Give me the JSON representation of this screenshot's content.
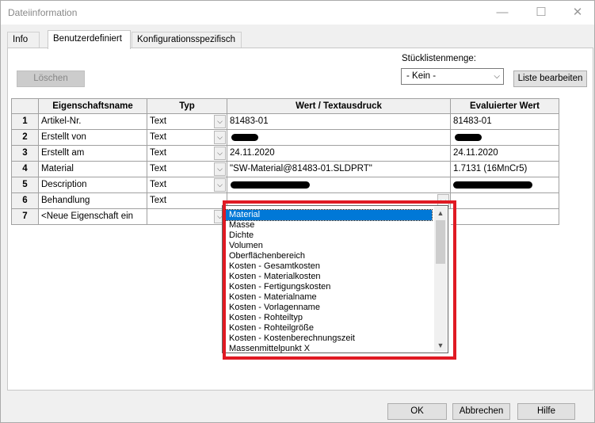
{
  "window": {
    "title": "Dateiinformation",
    "minimize_icon": "—",
    "maximize_icon": "☐",
    "close_icon": "✕"
  },
  "tabs": [
    {
      "label": "Info",
      "active": false
    },
    {
      "label": "Benutzerdefiniert",
      "active": true
    },
    {
      "label": "Konfigurationsspezifisch",
      "active": false
    }
  ],
  "toolbar": {
    "delete_label": "Löschen",
    "bom_quantity_label": "Stücklistenmenge:",
    "bom_quantity_value": "- Kein -",
    "edit_list_label": "Liste bearbeiten"
  },
  "table": {
    "headers": [
      "Eigenschaftsname",
      "Typ",
      "Wert / Textausdruck",
      "Evaluierter Wert"
    ],
    "rows": [
      {
        "num": "1",
        "name": "Artikel-Nr.",
        "type": "Text",
        "value": "81483-01",
        "evaluated": "81483-01"
      },
      {
        "num": "2",
        "name": "Erstellt von",
        "type": "Text",
        "value": "",
        "evaluated": ""
      },
      {
        "num": "3",
        "name": "Erstellt am",
        "type": "Text",
        "value": "24.11.2020",
        "evaluated": "24.11.2020"
      },
      {
        "num": "4",
        "name": "Material",
        "type": "Text",
        "value": "\"SW-Material@81483-01.SLDPRT\"",
        "evaluated": "1.7131 (16MnCr5)"
      },
      {
        "num": "5",
        "name": "Description",
        "type": "Text",
        "value": "",
        "evaluated": ""
      },
      {
        "num": "6",
        "name": "Behandlung",
        "type": "Text",
        "value": "",
        "evaluated": ""
      },
      {
        "num": "7",
        "name": "<Neue Eigenschaft ein",
        "type": "",
        "value": "",
        "evaluated": ""
      }
    ]
  },
  "dropdown": {
    "items": [
      "Material",
      "Masse",
      "Dichte",
      "Volumen",
      "Oberflächenbereich",
      "Kosten - Gesamtkosten",
      "Kosten - Materialkosten",
      "Kosten - Fertigungskosten",
      "Kosten - Materialname",
      "Kosten - Vorlagenname",
      "Kosten - Rohteiltyp",
      "Kosten - Rohteilgröße",
      "Kosten - Kostenberechnungszeit",
      "Massenmittelpunkt X"
    ],
    "selected": "Material",
    "highlight_color": "#e01a23",
    "selection_color": "#0078d7"
  },
  "footer": {
    "ok_label": "OK",
    "cancel_label": "Abbrechen",
    "help_label": "Hilfe"
  }
}
